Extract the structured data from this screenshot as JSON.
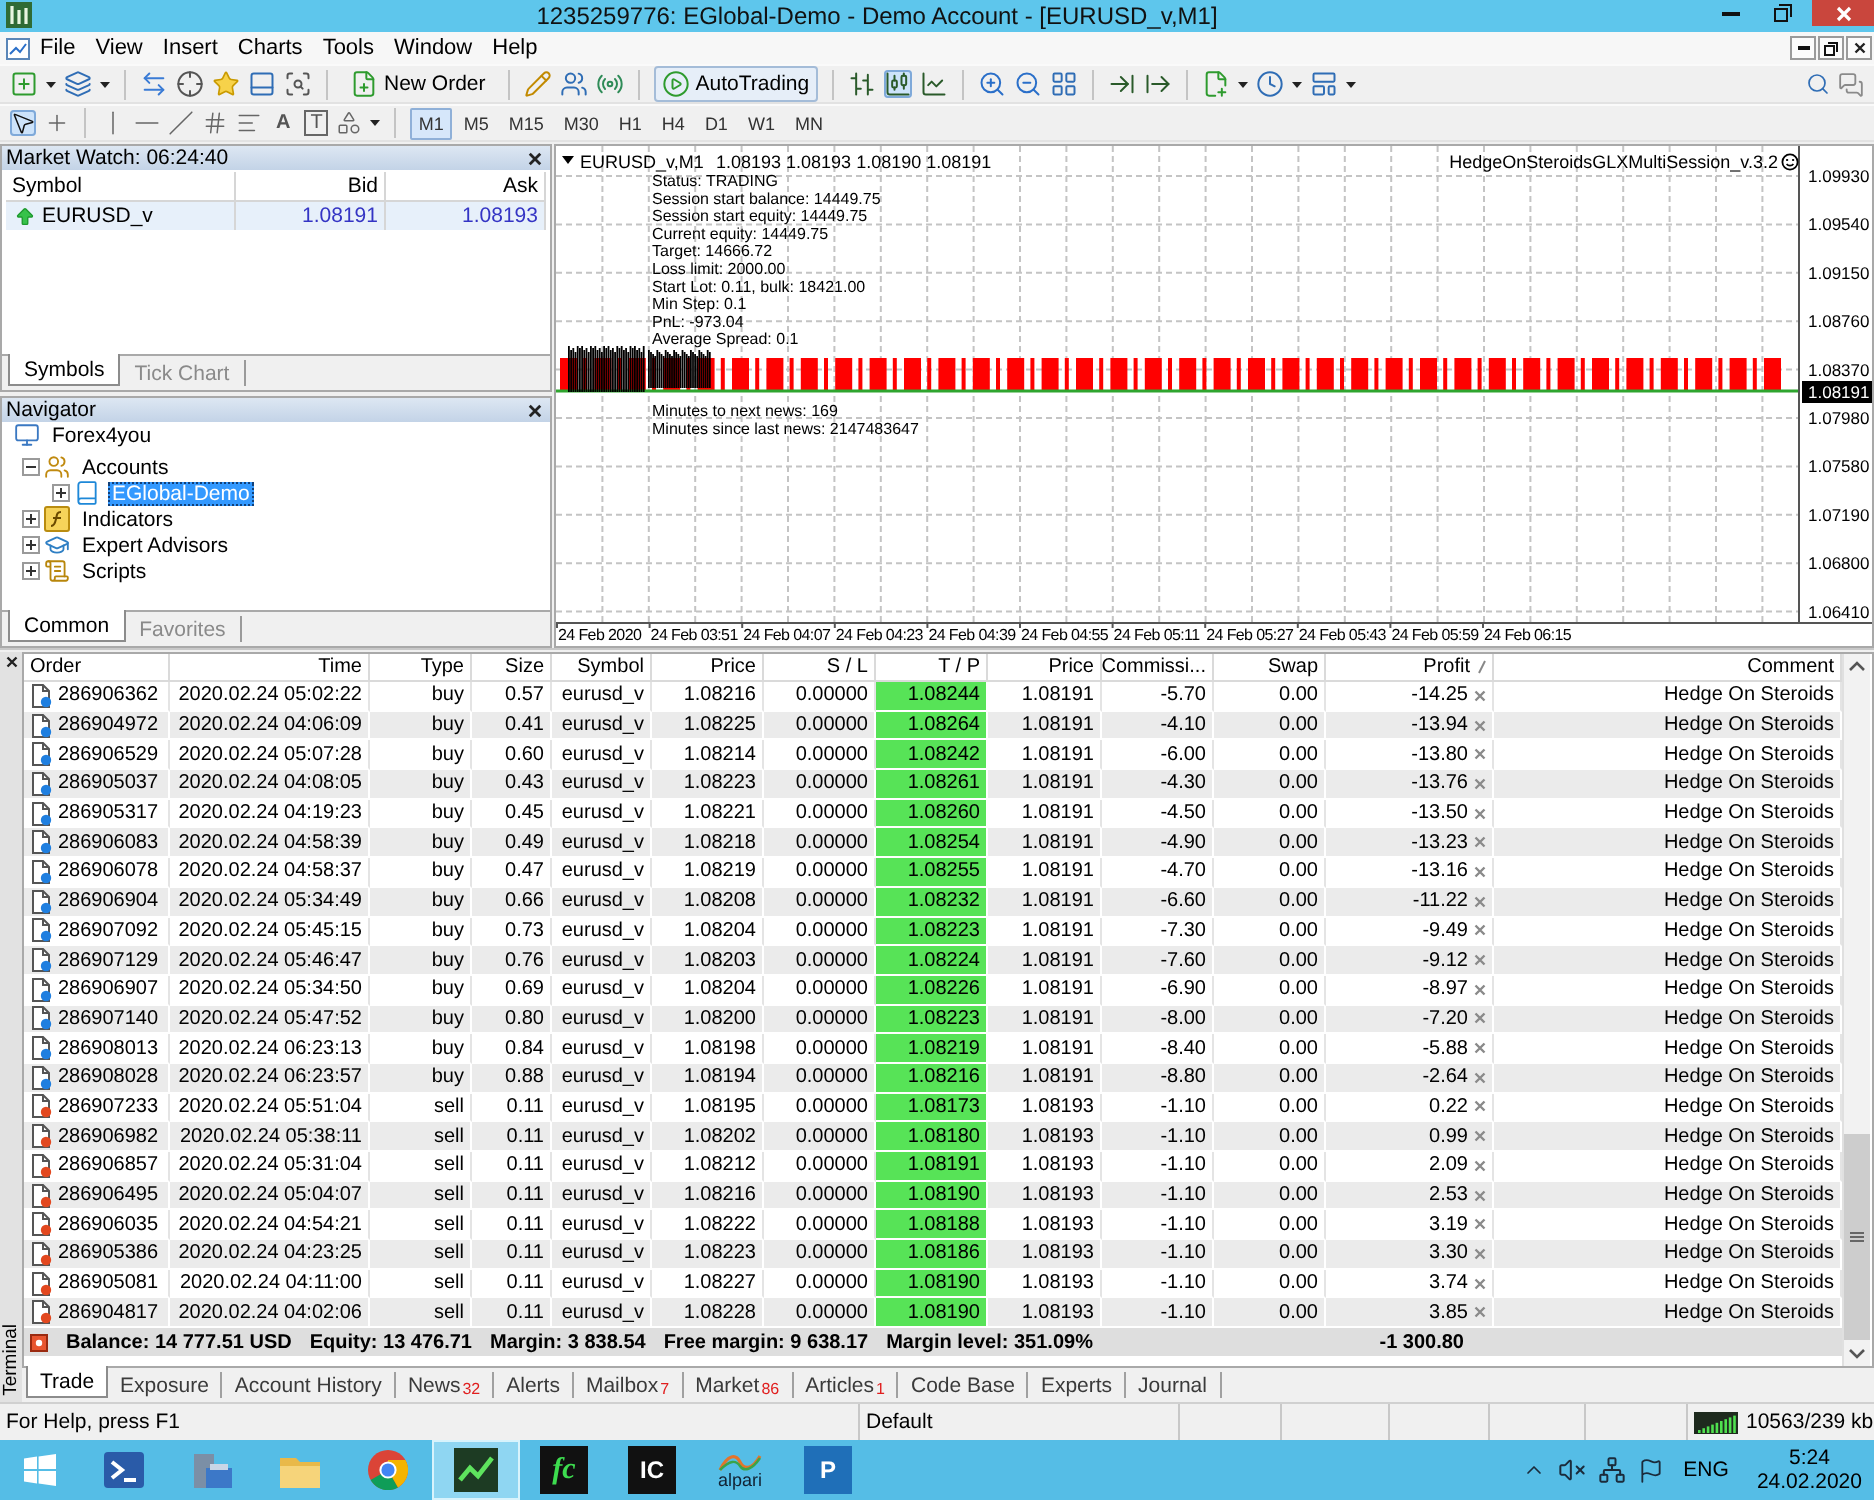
{
  "window": {
    "title": "1235259776: EGlobal-Demo - Demo Account - [EURUSD_v,M1]"
  },
  "menu": [
    "File",
    "View",
    "Insert",
    "Charts",
    "Tools",
    "Window",
    "Help"
  ],
  "toolbar": {
    "new_order": "New Order",
    "autotrading": {
      "label": "AutoTrading",
      "on": true
    },
    "chart_types": [
      {
        "selected": false
      },
      {
        "selected": true
      },
      {
        "selected": false
      }
    ]
  },
  "drawing_tools": [
    {
      "kind": "cursor",
      "selected": true
    },
    {
      "kind": "crosshair",
      "selected": false
    },
    {
      "kind": "vertical_line",
      "selected": false
    },
    {
      "kind": "horizontal_line",
      "selected": false
    },
    {
      "kind": "trendline",
      "selected": false
    },
    {
      "kind": "channel",
      "selected": false
    },
    {
      "kind": "fibonacci",
      "selected": false
    },
    {
      "kind": "text",
      "label": "A",
      "selected": false
    },
    {
      "kind": "text_label",
      "label": "T",
      "selected": false
    },
    {
      "kind": "arrows",
      "selected": false
    }
  ],
  "timeframes": [
    {
      "label": "M1",
      "selected": true
    },
    {
      "label": "M5",
      "selected": false
    },
    {
      "label": "M15",
      "selected": false
    },
    {
      "label": "M30",
      "selected": false
    },
    {
      "label": "H1",
      "selected": false
    },
    {
      "label": "H4",
      "selected": false
    },
    {
      "label": "D1",
      "selected": false
    },
    {
      "label": "W1",
      "selected": false
    },
    {
      "label": "MN",
      "selected": false
    }
  ],
  "market_watch": {
    "title": "Market Watch: 06:24:40",
    "columns": [
      "Symbol",
      "Bid",
      "Ask"
    ],
    "rows": [
      {
        "symbol": "EURUSD_v",
        "bid": "1.08191",
        "ask": "1.08193"
      }
    ],
    "tabs": [
      {
        "label": "Symbols",
        "selected": true
      },
      {
        "label": "Tick Chart",
        "selected": false
      }
    ]
  },
  "navigator": {
    "title": "Navigator",
    "tree": [
      {
        "label": "Forex4you",
        "kind": "broker",
        "selected": false,
        "children": [
          {
            "label": "Accounts",
            "kind": "accounts",
            "expanded": true,
            "selected": false,
            "children": [
              {
                "label": "EGlobal-Demo",
                "kind": "account",
                "expanded": false,
                "selected": true
              }
            ]
          },
          {
            "label": "Indicators",
            "kind": "indicators",
            "expanded": false,
            "selected": false
          },
          {
            "label": "Expert Advisors",
            "kind": "experts",
            "expanded": false,
            "selected": false
          },
          {
            "label": "Scripts",
            "kind": "scripts",
            "expanded": false,
            "selected": false
          }
        ]
      }
    ],
    "tabs": [
      {
        "label": "Common",
        "selected": true
      },
      {
        "label": "Favorites",
        "selected": false
      }
    ]
  },
  "chart": {
    "symbol": "EURUSD_v,M1",
    "ohlc": "1.08193 1.08193 1.08190 1.08191",
    "expert": "HedgeOnSteroidsGLXMultiSession_v.3.2",
    "info_lines": [
      "Status: TRADING",
      "Session start balance: 14449.75",
      "Session start equity: 14449.75",
      "Current equity: 14449.75",
      "Target: 14666.72",
      "Loss limit: 2000.00",
      "Start Lot: 0.11, bulk: 18421.00",
      "Min Step: 0.1",
      "PnL: -973.04",
      "Average Spread: 0.1"
    ],
    "news_lines": [
      "Minutes to next news: 169",
      "Minutes since last news: 2147483647"
    ],
    "price_labels": [
      "1.09930",
      "1.09540",
      "1.09150",
      "1.08760",
      "1.08370",
      "1.07980",
      "1.07580",
      "1.07190",
      "1.06800",
      "1.06410"
    ],
    "current_price": "1.08191",
    "time_labels": [
      "24 Feb 2020",
      "24 Feb 03:51",
      "24 Feb 04:07",
      "24 Feb 04:23",
      "24 Feb 04:39",
      "24 Feb 04:55",
      "24 Feb 05:11",
      "24 Feb 05:27",
      "24 Feb 05:43",
      "24 Feb 05:59",
      "24 Feb 06:15"
    ]
  },
  "terminal": {
    "title": "Terminal",
    "columns": [
      "Order",
      "Time",
      "Type",
      "Size",
      "Symbol",
      "Price",
      "S / L",
      "T / P",
      "Price",
      "Commissi...",
      "Swap",
      "Profit",
      "Comment"
    ],
    "rows": [
      {
        "kind": "buy",
        "cells": [
          "286906362",
          "2020.02.24 05:02:22",
          "buy",
          "0.57",
          "eurusd_v",
          "1.08216",
          "0.00000",
          "1.08244",
          "1.08191",
          "-5.70",
          "0.00",
          "-14.25",
          "Hedge On Steroids"
        ]
      },
      {
        "kind": "buy",
        "cells": [
          "286904972",
          "2020.02.24 04:06:09",
          "buy",
          "0.41",
          "eurusd_v",
          "1.08225",
          "0.00000",
          "1.08264",
          "1.08191",
          "-4.10",
          "0.00",
          "-13.94",
          "Hedge On Steroids"
        ]
      },
      {
        "kind": "buy",
        "cells": [
          "286906529",
          "2020.02.24 05:07:28",
          "buy",
          "0.60",
          "eurusd_v",
          "1.08214",
          "0.00000",
          "1.08242",
          "1.08191",
          "-6.00",
          "0.00",
          "-13.80",
          "Hedge On Steroids"
        ]
      },
      {
        "kind": "buy",
        "cells": [
          "286905037",
          "2020.02.24 04:08:05",
          "buy",
          "0.43",
          "eurusd_v",
          "1.08223",
          "0.00000",
          "1.08261",
          "1.08191",
          "-4.30",
          "0.00",
          "-13.76",
          "Hedge On Steroids"
        ]
      },
      {
        "kind": "buy",
        "cells": [
          "286905317",
          "2020.02.24 04:19:23",
          "buy",
          "0.45",
          "eurusd_v",
          "1.08221",
          "0.00000",
          "1.08260",
          "1.08191",
          "-4.50",
          "0.00",
          "-13.50",
          "Hedge On Steroids"
        ]
      },
      {
        "kind": "buy",
        "cells": [
          "286906083",
          "2020.02.24 04:58:39",
          "buy",
          "0.49",
          "eurusd_v",
          "1.08218",
          "0.00000",
          "1.08254",
          "1.08191",
          "-4.90",
          "0.00",
          "-13.23",
          "Hedge On Steroids"
        ]
      },
      {
        "kind": "buy",
        "cells": [
          "286906078",
          "2020.02.24 04:58:37",
          "buy",
          "0.47",
          "eurusd_v",
          "1.08219",
          "0.00000",
          "1.08255",
          "1.08191",
          "-4.70",
          "0.00",
          "-13.16",
          "Hedge On Steroids"
        ]
      },
      {
        "kind": "buy",
        "cells": [
          "286906904",
          "2020.02.24 05:34:49",
          "buy",
          "0.66",
          "eurusd_v",
          "1.08208",
          "0.00000",
          "1.08232",
          "1.08191",
          "-6.60",
          "0.00",
          "-11.22",
          "Hedge On Steroids"
        ]
      },
      {
        "kind": "buy",
        "cells": [
          "286907092",
          "2020.02.24 05:45:15",
          "buy",
          "0.73",
          "eurusd_v",
          "1.08204",
          "0.00000",
          "1.08223",
          "1.08191",
          "-7.30",
          "0.00",
          "-9.49",
          "Hedge On Steroids"
        ]
      },
      {
        "kind": "buy",
        "cells": [
          "286907129",
          "2020.02.24 05:46:47",
          "buy",
          "0.76",
          "eurusd_v",
          "1.08203",
          "0.00000",
          "1.08224",
          "1.08191",
          "-7.60",
          "0.00",
          "-9.12",
          "Hedge On Steroids"
        ]
      },
      {
        "kind": "buy",
        "cells": [
          "286906907",
          "2020.02.24 05:34:50",
          "buy",
          "0.69",
          "eurusd_v",
          "1.08204",
          "0.00000",
          "1.08226",
          "1.08191",
          "-6.90",
          "0.00",
          "-8.97",
          "Hedge On Steroids"
        ]
      },
      {
        "kind": "buy",
        "cells": [
          "286907140",
          "2020.02.24 05:47:52",
          "buy",
          "0.80",
          "eurusd_v",
          "1.08200",
          "0.00000",
          "1.08223",
          "1.08191",
          "-8.00",
          "0.00",
          "-7.20",
          "Hedge On Steroids"
        ]
      },
      {
        "kind": "buy",
        "cells": [
          "286908013",
          "2020.02.24 06:23:13",
          "buy",
          "0.84",
          "eurusd_v",
          "1.08198",
          "0.00000",
          "1.08219",
          "1.08191",
          "-8.40",
          "0.00",
          "-5.88",
          "Hedge On Steroids"
        ]
      },
      {
        "kind": "buy",
        "cells": [
          "286908028",
          "2020.02.24 06:23:57",
          "buy",
          "0.88",
          "eurusd_v",
          "1.08194",
          "0.00000",
          "1.08216",
          "1.08191",
          "-8.80",
          "0.00",
          "-2.64",
          "Hedge On Steroids"
        ]
      },
      {
        "kind": "sell",
        "cells": [
          "286907233",
          "2020.02.24 05:51:04",
          "sell",
          "0.11",
          "eurusd_v",
          "1.08195",
          "0.00000",
          "1.08173",
          "1.08193",
          "-1.10",
          "0.00",
          "0.22",
          "Hedge On Steroids"
        ]
      },
      {
        "kind": "sell",
        "cells": [
          "286906982",
          "2020.02.24 05:38:11",
          "sell",
          "0.11",
          "eurusd_v",
          "1.08202",
          "0.00000",
          "1.08180",
          "1.08193",
          "-1.10",
          "0.00",
          "0.99",
          "Hedge On Steroids"
        ]
      },
      {
        "kind": "sell",
        "cells": [
          "286906857",
          "2020.02.24 05:31:04",
          "sell",
          "0.11",
          "eurusd_v",
          "1.08212",
          "0.00000",
          "1.08191",
          "1.08193",
          "-1.10",
          "0.00",
          "2.09",
          "Hedge On Steroids"
        ]
      },
      {
        "kind": "sell",
        "cells": [
          "286906495",
          "2020.02.24 05:04:07",
          "sell",
          "0.11",
          "eurusd_v",
          "1.08216",
          "0.00000",
          "1.08190",
          "1.08193",
          "-1.10",
          "0.00",
          "2.53",
          "Hedge On Steroids"
        ]
      },
      {
        "kind": "sell",
        "cells": [
          "286906035",
          "2020.02.24 04:54:21",
          "sell",
          "0.11",
          "eurusd_v",
          "1.08222",
          "0.00000",
          "1.08188",
          "1.08193",
          "-1.10",
          "0.00",
          "3.19",
          "Hedge On Steroids"
        ]
      },
      {
        "kind": "sell",
        "cells": [
          "286905386",
          "2020.02.24 04:23:25",
          "sell",
          "0.11",
          "eurusd_v",
          "1.08223",
          "0.00000",
          "1.08186",
          "1.08193",
          "-1.10",
          "0.00",
          "3.30",
          "Hedge On Steroids"
        ]
      },
      {
        "kind": "sell",
        "cells": [
          "286905081",
          "2020.02.24 04:11:00",
          "sell",
          "0.11",
          "eurusd_v",
          "1.08227",
          "0.00000",
          "1.08190",
          "1.08193",
          "-1.10",
          "0.00",
          "3.74",
          "Hedge On Steroids"
        ]
      },
      {
        "kind": "sell",
        "cells": [
          "286904817",
          "2020.02.24 04:02:06",
          "sell",
          "0.11",
          "eurusd_v",
          "1.08228",
          "0.00000",
          "1.08190",
          "1.08193",
          "-1.10",
          "0.00",
          "3.85",
          "Hedge On Steroids"
        ]
      }
    ],
    "summary": {
      "items": [
        "Balance: 14 777.51 USD",
        "Equity: 13 476.71",
        "Margin: 3 838.54",
        "Free margin: 9 638.17",
        "Margin level: 351.09%"
      ],
      "profit": "-1 300.80"
    },
    "tabs": [
      {
        "label": "Trade",
        "selected": true
      },
      {
        "label": "Exposure",
        "selected": false
      },
      {
        "label": "Account History",
        "selected": false
      },
      {
        "label": "News",
        "badge": "32",
        "selected": false
      },
      {
        "label": "Alerts",
        "selected": false
      },
      {
        "label": "Mailbox",
        "badge": "7",
        "selected": false
      },
      {
        "label": "Market",
        "badge": "86",
        "selected": false
      },
      {
        "label": "Articles",
        "badge": "1",
        "selected": false
      },
      {
        "label": "Code Base",
        "selected": false
      },
      {
        "label": "Experts",
        "selected": false
      },
      {
        "label": "Journal",
        "selected": false
      }
    ]
  },
  "status_bar": {
    "help": "For Help, press F1",
    "profile": "Default",
    "traffic": "10563/239 kb"
  },
  "taskbar": {
    "apps": [
      {
        "kind": "powershell",
        "active": false
      },
      {
        "kind": "server",
        "active": false
      },
      {
        "kind": "explorer",
        "active": false
      },
      {
        "kind": "browser",
        "active": false
      },
      {
        "kind": "fxl",
        "active": true
      },
      {
        "kind": "fc",
        "label": "fc",
        "active": false
      },
      {
        "kind": "ic",
        "label": "IC",
        "active": false
      },
      {
        "kind": "alpari",
        "label": "alpari",
        "active": false
      },
      {
        "kind": "p",
        "label": "P",
        "active": false
      }
    ],
    "language": "ENG",
    "time": "5:24",
    "date": "24.02.2020"
  }
}
